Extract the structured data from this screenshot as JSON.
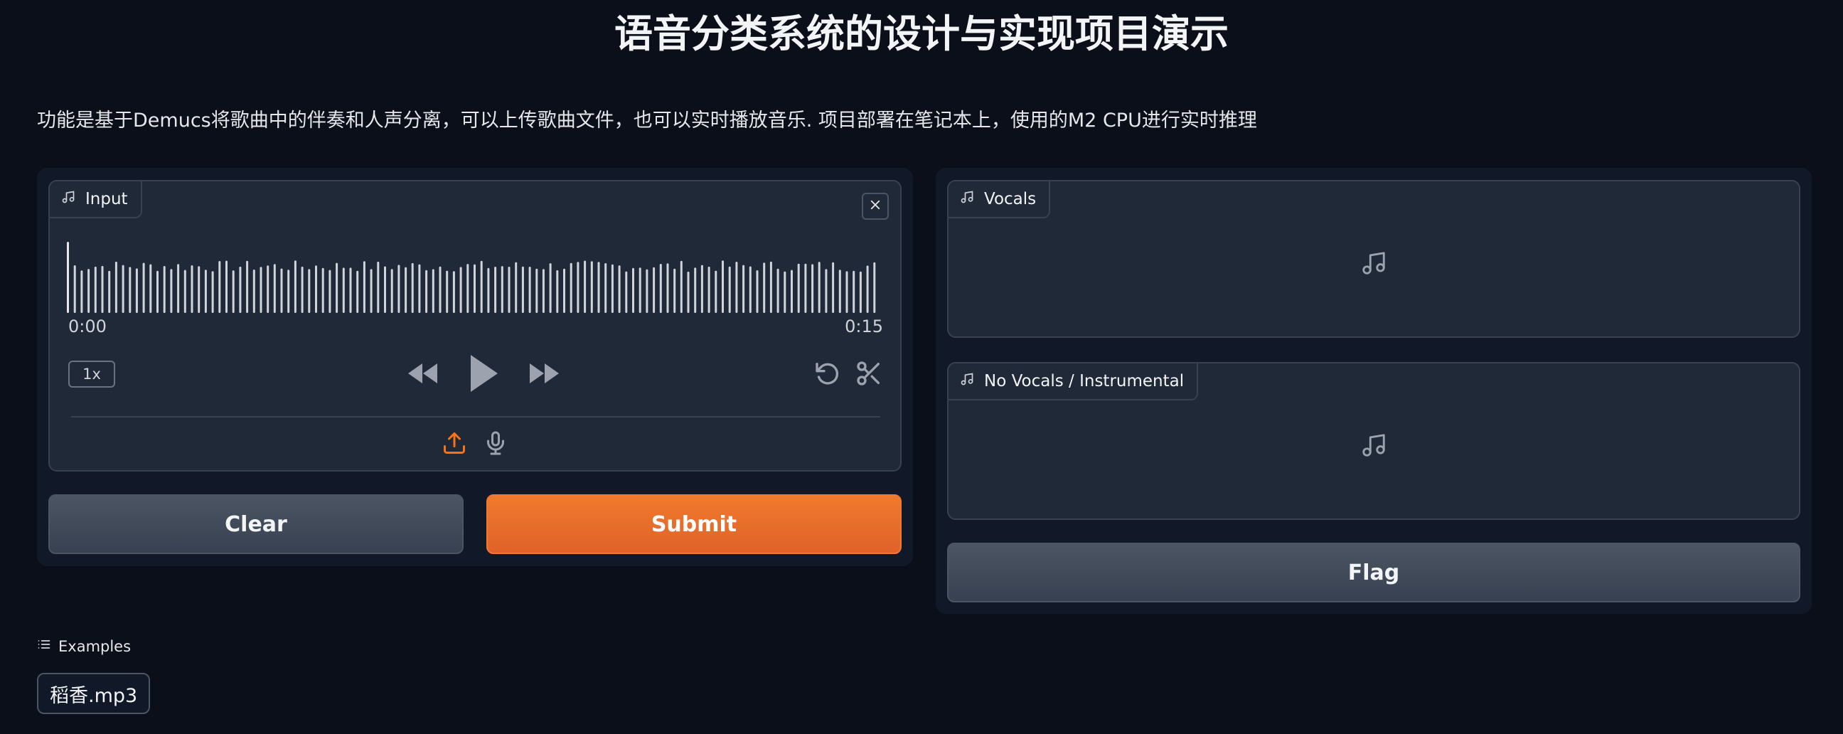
{
  "header": {
    "title": "语音分类系统的设计与实现项目演示",
    "description": "功能是基于Demucs将歌曲中的伴奏和人声分离，可以上传歌曲文件，也可以实时播放音乐. 项目部署在笔记本上，使用的M2 CPU进行实时推理"
  },
  "input": {
    "label": "Input",
    "time_start": "0:00",
    "time_end": "0:15",
    "speed": "1x",
    "icons": [
      "music-note-icon",
      "close-icon",
      "rewind-icon",
      "play-icon",
      "fast-forward-icon",
      "undo-icon",
      "scissors-icon",
      "upload-icon",
      "microphone-icon"
    ]
  },
  "buttons": {
    "clear": "Clear",
    "submit": "Submit",
    "flag": "Flag"
  },
  "outputs": {
    "vocals_label": "Vocals",
    "instrumental_label": "No Vocals / Instrumental"
  },
  "examples": {
    "label": "Examples",
    "items": [
      "稻香.mp3"
    ]
  },
  "colors": {
    "background": "#0b0f19",
    "panel": "#111827",
    "block": "#1f2937",
    "accent": "#e9702c",
    "upload_icon": "#f97316"
  }
}
